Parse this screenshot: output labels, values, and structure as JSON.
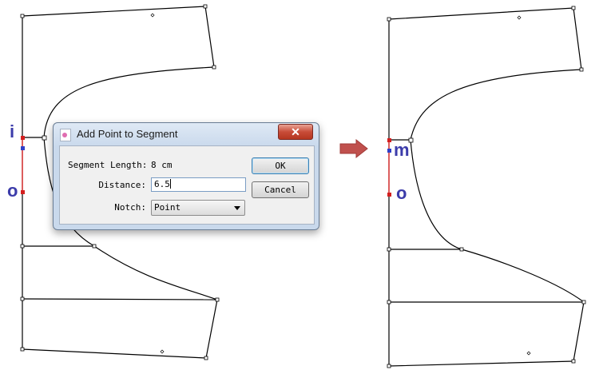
{
  "dialog": {
    "title": "Add Point to Segment",
    "close_glyph": "✕",
    "segment_length_label": "Segment Length:",
    "segment_length_value": "8 cm",
    "distance_label": "Distance:",
    "distance_value": "6.5",
    "notch_label": "Notch:",
    "notch_value": "Point",
    "ok_label": "OK",
    "cancel_label": "Cancel"
  },
  "labels": {
    "before_top": "i",
    "before_bottom": "o",
    "after_top": "m",
    "after_bottom": "o"
  },
  "colors": {
    "label": "#3c3caa",
    "highlight_segment": "#e23a3a",
    "point_red": "#d41f1f",
    "point_blue": "#2f3fc8",
    "arrow": "#c0504d"
  },
  "icons": {
    "arrow": "right-arrow-icon",
    "dialog": "app-icon"
  }
}
